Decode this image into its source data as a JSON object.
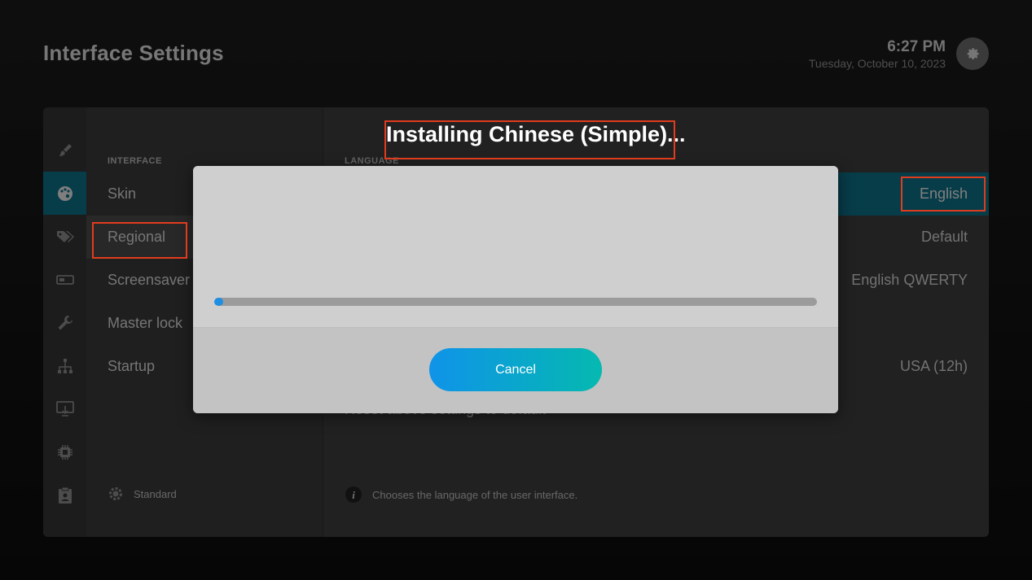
{
  "header": {
    "title": "Interface Settings",
    "time": "6:27 PM",
    "date": "Tuesday, October 10, 2023",
    "settings_icon": "gear-icon"
  },
  "iconbar": {
    "icons": [
      "brush-icon",
      "palette-icon",
      "tags-icon",
      "input-device-icon",
      "wrench-icon",
      "network-icon",
      "display-icon",
      "chip-icon",
      "clipboard-icon"
    ],
    "active_index": 1
  },
  "categories": {
    "heading": "INTERFACE",
    "items": [
      {
        "label": "Skin"
      },
      {
        "label": "Regional"
      },
      {
        "label": "Screensaver"
      },
      {
        "label": "Master lock"
      },
      {
        "label": "Startup"
      }
    ],
    "level_label": "Standard"
  },
  "settings": {
    "heading": "LANGUAGE",
    "rows": [
      {
        "label": "",
        "value": "English"
      },
      {
        "label": "",
        "value": "Default"
      },
      {
        "label": "",
        "value": "English QWERTY"
      },
      {
        "label": "",
        "value": ""
      },
      {
        "label": "",
        "value": "USA (12h)"
      }
    ],
    "reset_label": "Reset above settings to default",
    "description": "Chooses the language of the user interface."
  },
  "dialog": {
    "title": "Installing Chinese (Simple)...",
    "progress": 0.015,
    "cancel_label": "Cancel"
  },
  "colors": {
    "accent": "#0d6d86",
    "progress": "#1e8fe3",
    "highlight_box": "#e03c1e"
  }
}
